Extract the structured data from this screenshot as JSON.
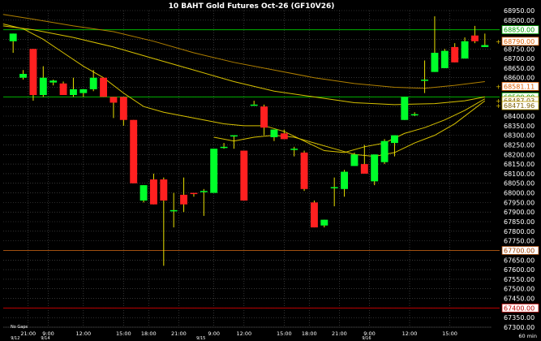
{
  "colors": {
    "background": "#000000",
    "grid": "#555555",
    "up_candle": "#00ff2a",
    "down_candle": "#ff2020",
    "wick": "#e8e000",
    "ma_line": "#d7c100",
    "ma_long_line": "#b08000",
    "hline_green": "#00b000",
    "hline_brown": "#a05010",
    "hline_red": "#c00000",
    "axis_text": "#ffffff",
    "title_text": "#ffffff",
    "label_bg": "#ffffff"
  },
  "chart_data": {
    "type": "candlestick",
    "title": "10 BAHT Gold Futures Oct-26 (GF10V26)",
    "timeframe": "60 min",
    "gaps_note": "No Gaps",
    "y_axis": {
      "min": 67300,
      "max": 68950,
      "ticks": [
        "68950.00",
        "68900.00",
        "68850.00",
        "68800.00",
        "68750.00",
        "68700.00",
        "68650.00",
        "68600.00",
        "68550.00",
        "68500.00",
        "68450.00",
        "68400.00",
        "68350.00",
        "68300.00",
        "68250.00",
        "68200.00",
        "68150.00",
        "68100.00",
        "68050.00",
        "68000.00",
        "67950.00",
        "67900.00",
        "67850.00",
        "67800.00",
        "67750.00",
        "67700.00",
        "67650.00",
        "67600.00",
        "67550.00",
        "67500.00",
        "67450.00",
        "67400.00",
        "67350.00",
        "67300.00"
      ],
      "tick_values": [
        68950,
        68900,
        68850,
        68800,
        68750,
        68700,
        68650,
        68600,
        68550,
        68500,
        68450,
        68400,
        68350,
        68300,
        68250,
        68200,
        68150,
        68100,
        68050,
        68000,
        67950,
        67900,
        67850,
        67800,
        67750,
        67700,
        67650,
        67600,
        67550,
        67500,
        67450,
        67400,
        67350,
        67300
      ]
    },
    "x_axis": {
      "time_labels": [
        {
          "index": 1.5,
          "text": "21:00"
        },
        {
          "index": 3.5,
          "text": "9:00"
        },
        {
          "index": 7,
          "text": "12:00"
        },
        {
          "index": 11,
          "text": "15:00"
        },
        {
          "index": 13.5,
          "text": "18:00"
        },
        {
          "index": 16.5,
          "text": "21:00"
        },
        {
          "index": 20,
          "text": "9:00"
        },
        {
          "index": 23,
          "text": "12:00"
        },
        {
          "index": 27,
          "text": "15:00"
        },
        {
          "index": 29.5,
          "text": "18:00"
        },
        {
          "index": 32.5,
          "text": "21:00"
        },
        {
          "index": 35.5,
          "text": "9:00"
        },
        {
          "index": 39.5,
          "text": "12:00"
        },
        {
          "index": 43.5,
          "text": "15:00"
        }
      ],
      "date_labels": [
        {
          "index": 0,
          "text": "9/12"
        },
        {
          "index": 3,
          "text": "9/14"
        },
        {
          "index": 18.5,
          "text": "9/15"
        },
        {
          "index": 35,
          "text": "9/16"
        }
      ]
    },
    "candles": [
      {
        "o": 68790,
        "h": 68830,
        "l": 68730,
        "c": 68830
      },
      {
        "o": 68600,
        "h": 68640,
        "l": 68590,
        "c": 68620
      },
      {
        "o": 68750,
        "h": 68750,
        "l": 68480,
        "c": 68510
      },
      {
        "o": 68510,
        "h": 68660,
        "l": 68500,
        "c": 68600
      },
      {
        "o": 68575,
        "h": 68590,
        "l": 68560,
        "c": 68585
      },
      {
        "o": 68570,
        "h": 68580,
        "l": 68510,
        "c": 68510
      },
      {
        "o": 68510,
        "h": 68600,
        "l": 68500,
        "c": 68540
      },
      {
        "o": 68520,
        "h": 68540,
        "l": 68500,
        "c": 68540
      },
      {
        "o": 68540,
        "h": 68640,
        "l": 68530,
        "c": 68600
      },
      {
        "o": 68600,
        "h": 68600,
        "l": 68500,
        "c": 68500
      },
      {
        "o": 68500,
        "h": 68500,
        "l": 68390,
        "c": 68470
      },
      {
        "o": 68500,
        "h": 68500,
        "l": 68350,
        "c": 68380
      },
      {
        "o": 68380,
        "h": 68380,
        "l": 68050,
        "c": 68050
      },
      {
        "o": 67960,
        "h": 68040,
        "l": 67950,
        "c": 68040
      },
      {
        "o": 68070,
        "h": 68100,
        "l": 67940,
        "c": 67940
      },
      {
        "o": 68070,
        "h": 68080,
        "l": 67620,
        "c": 67960
      },
      {
        "o": 67910,
        "h": 68000,
        "l": 67820,
        "c": 67910
      },
      {
        "o": 67990,
        "h": 68080,
        "l": 67900,
        "c": 67940
      },
      {
        "o": 68000,
        "h": 68000,
        "l": 67980,
        "c": 67995
      },
      {
        "o": 68010,
        "h": 68020,
        "l": 67880,
        "c": 68010
      },
      {
        "o": 68000,
        "h": 68230,
        "l": 68000,
        "c": 68230
      },
      {
        "o": 68240,
        "h": 68260,
        "l": 68230,
        "c": 68240
      },
      {
        "o": 68300,
        "h": 68300,
        "l": 68230,
        "c": 68300
      },
      {
        "o": 68220,
        "h": 68220,
        "l": 67960,
        "c": 67960
      },
      {
        "o": 68460,
        "h": 68480,
        "l": 68460,
        "c": 68460
      },
      {
        "o": 68450,
        "h": 68460,
        "l": 68300,
        "c": 68340
      },
      {
        "o": 68290,
        "h": 68330,
        "l": 68270,
        "c": 68330
      },
      {
        "o": 68310,
        "h": 68330,
        "l": 68280,
        "c": 68280
      },
      {
        "o": 68230,
        "h": 68240,
        "l": 68190,
        "c": 68230
      },
      {
        "o": 68210,
        "h": 68220,
        "l": 68010,
        "c": 68020
      },
      {
        "o": 67950,
        "h": 67960,
        "l": 67820,
        "c": 67820
      },
      {
        "o": 67830,
        "h": 67860,
        "l": 67820,
        "c": 67860
      },
      {
        "o": 68030,
        "h": 68080,
        "l": 67930,
        "c": 68030
      },
      {
        "o": 68020,
        "h": 68120,
        "l": 67980,
        "c": 68110
      },
      {
        "o": 68140,
        "h": 68210,
        "l": 68140,
        "c": 68200
      },
      {
        "o": 68150,
        "h": 68250,
        "l": 68110,
        "c": 68100
      },
      {
        "o": 68060,
        "h": 68200,
        "l": 68040,
        "c": 68200
      },
      {
        "o": 68160,
        "h": 68280,
        "l": 68150,
        "c": 68270
      },
      {
        "o": 68260,
        "h": 68300,
        "l": 68190,
        "c": 68300
      },
      {
        "o": 68380,
        "h": 68500,
        "l": 68380,
        "c": 68500
      },
      {
        "o": 68410,
        "h": 68420,
        "l": 68400,
        "c": 68410
      },
      {
        "o": 68590,
        "h": 68690,
        "l": 68520,
        "c": 68590
      },
      {
        "o": 68630,
        "h": 68920,
        "l": 68630,
        "c": 68730
      },
      {
        "o": 68650,
        "h": 68750,
        "l": 68650,
        "c": 68740
      },
      {
        "o": 68760,
        "h": 68780,
        "l": 68680,
        "c": 68680
      },
      {
        "o": 68700,
        "h": 68810,
        "l": 68700,
        "c": 68790
      },
      {
        "o": 68820,
        "h": 68870,
        "l": 68780,
        "c": 68790
      },
      {
        "o": 68760,
        "h": 68830,
        "l": 68760,
        "c": 68770
      }
    ],
    "moving_averages": [
      {
        "points": [
          [
            -1,
            68930
          ],
          [
            2,
            68905
          ],
          [
            6,
            68870
          ],
          [
            10,
            68840
          ],
          [
            14,
            68790
          ],
          [
            18,
            68730
          ],
          [
            22,
            68680
          ],
          [
            26,
            68640
          ],
          [
            30,
            68600
          ],
          [
            34,
            68570
          ],
          [
            38,
            68550
          ],
          [
            41,
            68545
          ],
          [
            44,
            68560
          ],
          [
            47,
            68580
          ]
        ]
      },
      {
        "points": [
          [
            -1,
            68870
          ],
          [
            2,
            68850
          ],
          [
            6,
            68810
          ],
          [
            10,
            68760
          ],
          [
            14,
            68700
          ],
          [
            18,
            68640
          ],
          [
            22,
            68580
          ],
          [
            26,
            68530
          ],
          [
            30,
            68500
          ],
          [
            34,
            68470
          ],
          [
            38,
            68460
          ],
          [
            42,
            68465
          ],
          [
            45,
            68480
          ],
          [
            47,
            68500
          ]
        ]
      },
      {
        "points": [
          [
            -1,
            68880
          ],
          [
            1,
            68855
          ],
          [
            3,
            68800
          ],
          [
            5,
            68730
          ],
          [
            7,
            68660
          ],
          [
            9,
            68600
          ],
          [
            11,
            68520
          ],
          [
            13,
            68450
          ],
          [
            15,
            68420
          ],
          [
            17,
            68400
          ],
          [
            19,
            68380
          ],
          [
            21,
            68360
          ],
          [
            23,
            68350
          ],
          [
            25,
            68350
          ],
          [
            27,
            68320
          ],
          [
            29,
            68270
          ],
          [
            31,
            68220
          ],
          [
            33,
            68210
          ],
          [
            35,
            68240
          ],
          [
            37,
            68260
          ],
          [
            39,
            68310
          ],
          [
            41,
            68340
          ],
          [
            43,
            68380
          ],
          [
            45,
            68430
          ],
          [
            47,
            68490
          ]
        ]
      },
      {
        "points": [
          [
            20,
            68290
          ],
          [
            22,
            68270
          ],
          [
            24,
            68290
          ],
          [
            26,
            68300
          ],
          [
            28,
            68290
          ],
          [
            30,
            68260
          ],
          [
            32,
            68230
          ],
          [
            34,
            68200
          ],
          [
            36,
            68190
          ],
          [
            38,
            68210
          ],
          [
            40,
            68260
          ],
          [
            42,
            68300
          ],
          [
            44,
            68360
          ],
          [
            47,
            68480
          ]
        ]
      }
    ],
    "horizontal_lines": [
      {
        "value": 68850,
        "role": "green"
      },
      {
        "value": 68500,
        "role": "green"
      },
      {
        "value": 67700,
        "role": "brown"
      },
      {
        "value": 67400,
        "role": "red"
      }
    ],
    "price_labels": [
      {
        "text": "68850.00",
        "value": 68850,
        "style": "green"
      },
      {
        "text": "68790.00",
        "value": 68790,
        "style": "orange"
      },
      {
        "text": "68581.11",
        "value": 68555,
        "style": "orange"
      },
      {
        "text": "68500.00",
        "value": 68500,
        "style": "green"
      },
      {
        "text": "68487.03",
        "value": 68480,
        "style": "yellow"
      },
      {
        "text": "68471.96",
        "value": 68455,
        "style": "yellow"
      },
      {
        "text": "67700.00",
        "value": 67700,
        "style": "brown"
      },
      {
        "text": "67400.00",
        "value": 67400,
        "style": "red"
      }
    ]
  }
}
